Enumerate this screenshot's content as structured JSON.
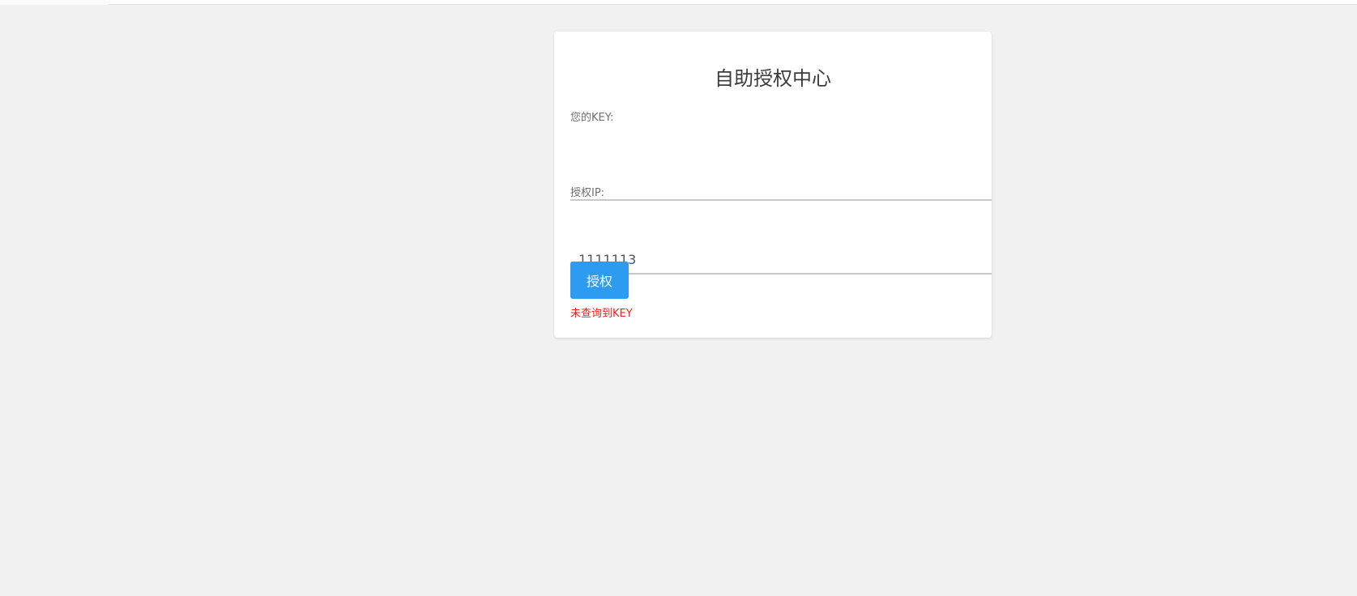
{
  "card": {
    "title": "自助授权中心",
    "key_field": {
      "label": "您的KEY:",
      "value": "",
      "placeholder": ""
    },
    "ip_field": {
      "label": "授权IP:",
      "value": "1111113",
      "placeholder": ""
    },
    "submit_label": "授权",
    "error_message": "未查询到KEY"
  },
  "colors": {
    "page_background": "#f1f1f1",
    "card_background": "#ffffff",
    "button_primary": "#2d9cf0",
    "error": "#ff1a1a",
    "title_text": "#3c3c3c",
    "label_text": "#6f6f6f"
  }
}
